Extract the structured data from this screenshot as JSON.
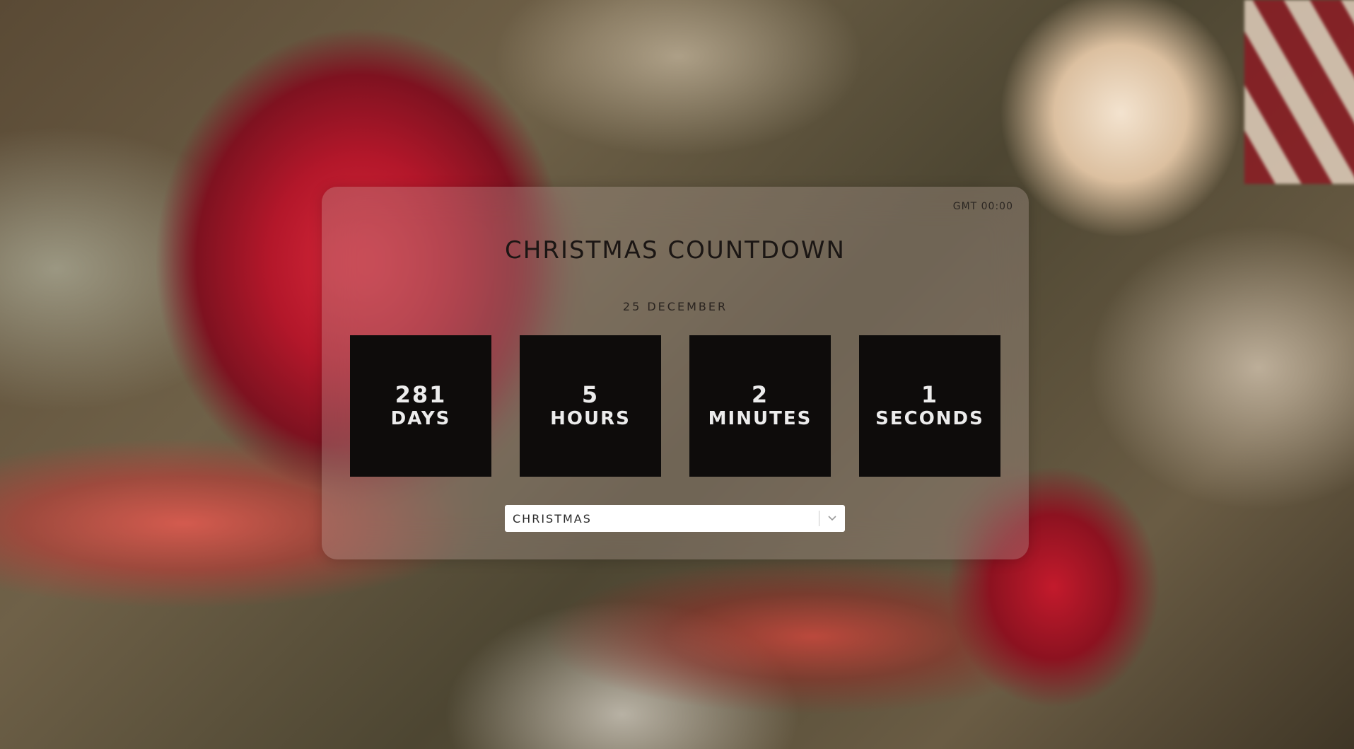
{
  "timezone_label": "GMT 00:00",
  "title": "CHRISTMAS COUNTDOWN",
  "event_date": "25 DECEMBER",
  "countdown": [
    {
      "value": "281",
      "unit": "DAYS"
    },
    {
      "value": "5",
      "unit": "HOURS"
    },
    {
      "value": "2",
      "unit": "MINUTES"
    },
    {
      "value": "1",
      "unit": "SECONDS"
    }
  ],
  "event_select": {
    "selected": "CHRISTMAS",
    "icon": "chevron-down-icon"
  },
  "colors": {
    "tile_background": "#0e0c0b",
    "tile_text": "#ececec",
    "title_text": "#1b1614"
  }
}
